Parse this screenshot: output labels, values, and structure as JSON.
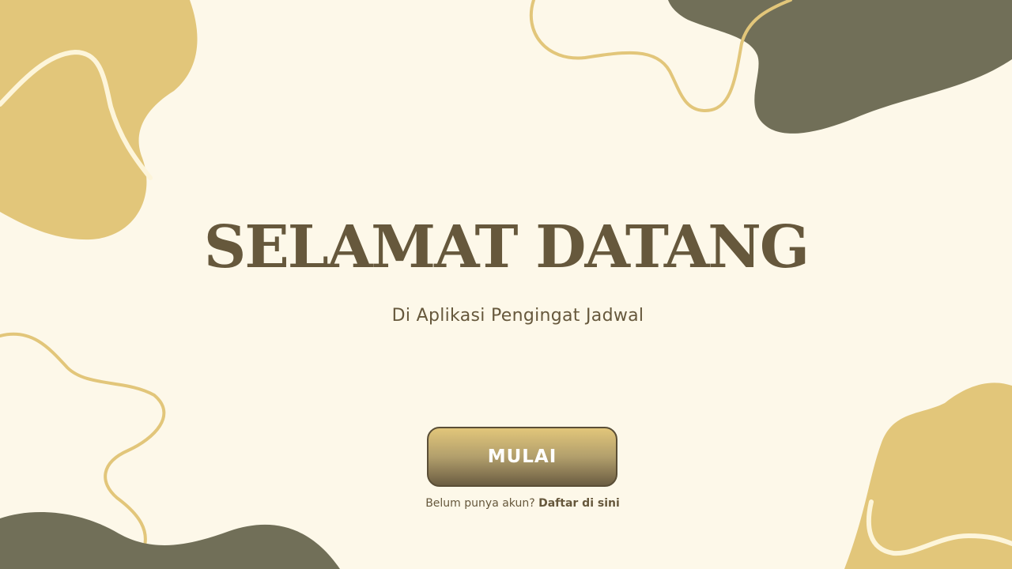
{
  "welcome": {
    "title": "SELAMAT DATANG",
    "subtitle": "Di Aplikasi Pengingat Jadwal"
  },
  "actions": {
    "start_label": "MULAI"
  },
  "signup": {
    "prompt": "Belum punya akun?",
    "link_label": "Daftar di sini"
  },
  "colors": {
    "background": "#FDF8E9",
    "accent_gold": "#E2C67A",
    "accent_olive": "#716F58",
    "text_brown": "#66583C",
    "line_cream": "#FDF5DA"
  }
}
